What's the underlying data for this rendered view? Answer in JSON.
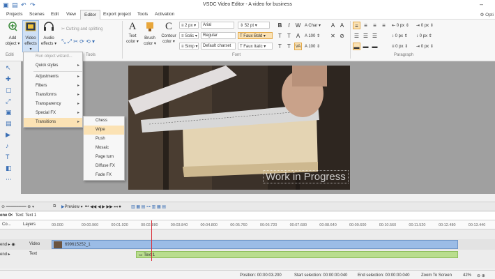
{
  "window": {
    "title": "VSDC Video Editor - A video for business"
  },
  "menu": {
    "items": [
      "Projects",
      "Scenes",
      "Edit",
      "View",
      "Editor",
      "Export project",
      "Tools",
      "Activation"
    ],
    "active": "Editor",
    "options_label": "Opti"
  },
  "ribbon": {
    "add_object": [
      "Add",
      "object"
    ],
    "video_effects": [
      "Video",
      "effects"
    ],
    "audio_effects": [
      "Audio",
      "effects"
    ],
    "cutting_splitting": "Cutting and splitting",
    "text_color": [
      "Text",
      "color"
    ],
    "brush_color": [
      "Brush",
      "color"
    ],
    "contour_color": [
      "Contour",
      "color"
    ],
    "group_editing": "Editi",
    "group_tools": "Tools",
    "group_font": "Font",
    "group_paragraph": "Paragraph",
    "stroke_width": "2 px",
    "stroke_style": "Solic",
    "stroke_mode": "Simp",
    "font_name": "Arial",
    "font_size": "52 pt",
    "font_weight": "Regular",
    "font_charset": "Default charset",
    "faux_bold": "Faux Bold",
    "faux_italic": "Faux Italic",
    "char_label": "Char",
    "pct_1": "100",
    "pct_2": "100",
    "para_values": [
      "0 px",
      "0 px",
      "0 px",
      "0 px",
      "0 px",
      "0 px"
    ]
  },
  "video_effects_menu": {
    "items": [
      {
        "label": "Run object wizard...",
        "disabled": true,
        "arrow": false
      },
      {
        "label": "Quick styles",
        "disabled": false,
        "arrow": true
      },
      {
        "label": "Adjustments",
        "disabled": false,
        "arrow": true
      },
      {
        "label": "Filters",
        "disabled": false,
        "arrow": true
      },
      {
        "label": "Transforms",
        "disabled": false,
        "arrow": true
      },
      {
        "label": "Transparency",
        "disabled": false,
        "arrow": true
      },
      {
        "label": "Special FX",
        "disabled": false,
        "arrow": true
      },
      {
        "label": "Transitions",
        "disabled": false,
        "arrow": true,
        "highlighted": true
      }
    ]
  },
  "transitions_menu": {
    "items": [
      "Chess",
      "Wipe",
      "Push",
      "Mosaic",
      "Page turn",
      "Diffuse FX",
      "Fade FX"
    ],
    "highlighted": "Wipe"
  },
  "preview": {
    "watermark": "Work in Progress"
  },
  "timeline": {
    "preview_label": "Preview",
    "tabs": [
      "ene 0",
      "Text: Text 1"
    ],
    "columns": [
      "Co...",
      "Layers"
    ],
    "ruler": [
      "00.000",
      "00:00.960",
      "00:01.920",
      "00:02.880",
      "00:03.840",
      "00:04.800",
      "00:05.760",
      "00:06.720",
      "00:07.680",
      "00:08.640",
      "00:09.600",
      "00:10.560",
      "00:11.520",
      "00:12.480",
      "00:13.440"
    ],
    "tracks": [
      {
        "blend": "end",
        "layer": "Video",
        "clip": "699615252_1"
      },
      {
        "blend": "end",
        "layer": "Text",
        "clip": "Text 1"
      }
    ]
  },
  "status": {
    "position_label": "Position:",
    "position": "00:00:03.200",
    "start_label": "Start selection:",
    "start": "00:00:00.040",
    "end_label": "End selection:",
    "end": "00:00:00.040",
    "zoom_label": "Zoom To Screen",
    "zoom": "42%"
  },
  "colors": {
    "accent": "#3a6fb5",
    "highlight": "#fbe2b4",
    "clip_video": "#9bbce6",
    "clip_text": "#b9dd8e",
    "playhead": "#d9303a"
  }
}
